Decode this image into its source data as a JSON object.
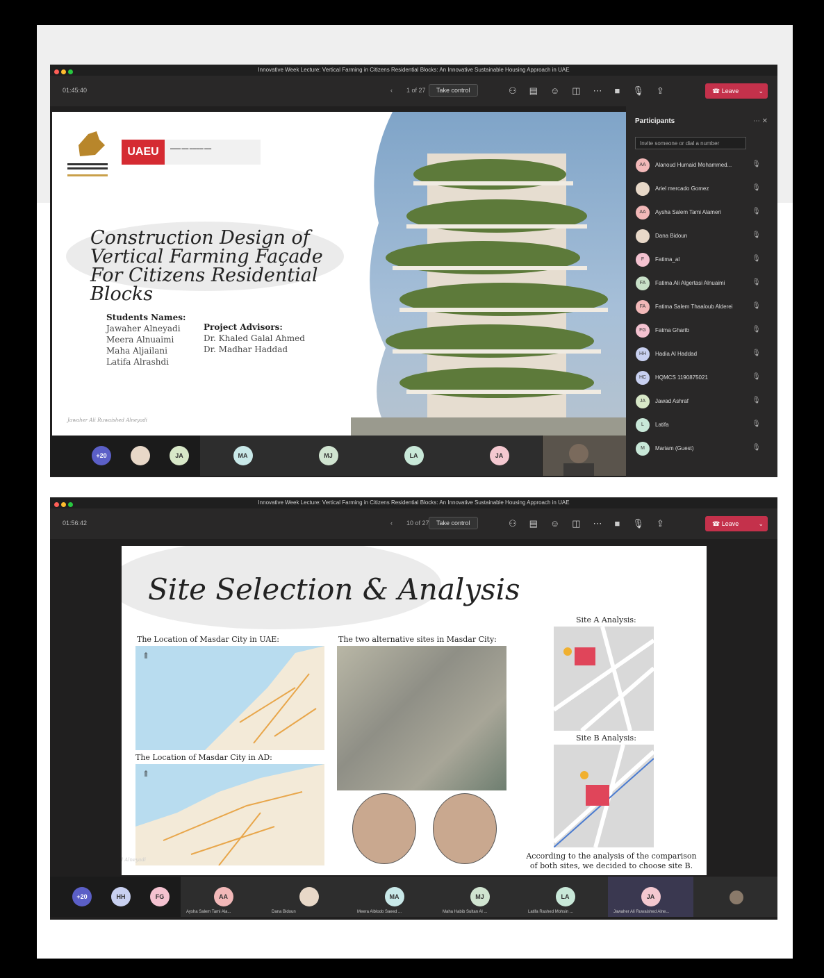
{
  "window_title": "Innovative Week Lecture: Vertical Farming in Citizens Residential Blocks: An Innovative Sustainable Housing Approach in UAE",
  "toolbar": {
    "take_control": "Take control",
    "leave": "Leave"
  },
  "meeting1": {
    "timer": "01:45:40",
    "slide_count": "1 of 27",
    "slide": {
      "title": "Construction Design of Vertical Farming Façade For Citizens Residential Blocks",
      "logo_text": "UAEU",
      "students_heading": "Students Names:",
      "students": [
        "Jawaher Alneyadi",
        "Meera Alnuaimi",
        "Maha Aljailani",
        "Latifa Alrashdi"
      ],
      "advisors_heading": "Project Advisors:",
      "advisors": [
        "Dr. Khaled Galal Ahmed",
        "Dr. Madhar Haddad"
      ],
      "footer": "Jawaher Ali Ruwaished Alneyadi"
    },
    "participants_title": "Participants",
    "invite_placeholder": "Invite someone or dial a number",
    "participants": [
      {
        "initials": "AA",
        "name": "Alanoud Humaid Mohammed...",
        "color": "#f2b8b8"
      },
      {
        "initials": "",
        "name": "Ariel mercado Gomez",
        "color": "#e8d8c8"
      },
      {
        "initials": "AA",
        "name": "Aysha Salem Tami Alameri",
        "color": "#f2b8b8"
      },
      {
        "initials": "",
        "name": "Dana Bidoun",
        "color": "#e8d8c8"
      },
      {
        "initials": "F",
        "name": "Fatima_al",
        "color": "#f4c2d0"
      },
      {
        "initials": "FA",
        "name": "Fatima Ali Algertasi Alnuaimi",
        "color": "#c8e0c8"
      },
      {
        "initials": "FA",
        "name": "Fatima Salem Thaaloub Alderei",
        "color": "#f2b8b8"
      },
      {
        "initials": "FG",
        "name": "Fatma Gharib",
        "color": "#f4c2d0"
      },
      {
        "initials": "HH",
        "name": "Hadia Al Haddad",
        "color": "#c8d0f0"
      },
      {
        "initials": "HC",
        "name": "HQMCS 1190875021",
        "color": "#c8d0f0"
      },
      {
        "initials": "JA",
        "name": "Jawad Ashraf",
        "color": "#d8e8c8"
      },
      {
        "initials": "L",
        "name": "Latifa",
        "color": "#c8e8d8"
      },
      {
        "initials": "M",
        "name": "Mariam (Guest)",
        "color": "#c8e8d8"
      }
    ],
    "strip": [
      {
        "initials": "+20",
        "color": "#5b5fc7"
      },
      {
        "initials": "",
        "color": "#e8d8c8"
      },
      {
        "initials": "JA",
        "color": "#d8e8c8"
      },
      {
        "initials": "MA",
        "color": "#c8e8e8"
      },
      {
        "initials": "MJ",
        "color": "#d0e4d0"
      },
      {
        "initials": "LA",
        "color": "#c8e8d8"
      },
      {
        "initials": "JA",
        "color": "#f4c8d0"
      }
    ]
  },
  "meeting2": {
    "timer": "01:56:42",
    "slide_count": "10 of 27",
    "slide": {
      "title": "Site Selection & Analysis",
      "cap_uae": "The Location of Masdar City in UAE:",
      "cap_ad": "The Location of Masdar City in AD:",
      "cap_sites": "The two alternative sites in Masdar City:",
      "site_a": "Site A Analysis:",
      "site_b": "Site B Analysis:",
      "conclusion": "According to the analysis of the comparison of both sites, we decided to choose site B.",
      "footer": "Jawaher Ali Ruwaished Alneyadi"
    },
    "strip": [
      {
        "initials": "+20",
        "color": "#5b5fc7",
        "name": ""
      },
      {
        "initials": "HH",
        "color": "#c8d0f0",
        "name": ""
      },
      {
        "initials": "FG",
        "color": "#f4c2d0",
        "name": ""
      },
      {
        "initials": "AA",
        "color": "#f2b8b8",
        "name": "Aysha Salem Tami Ala..."
      },
      {
        "initials": "",
        "color": "#e8d8c8",
        "name": "Dana Bidoun"
      },
      {
        "initials": "MA",
        "color": "#c8e8e8",
        "name": "Meera Albloob Saeed ..."
      },
      {
        "initials": "MJ",
        "color": "#d0e4d0",
        "name": "Maha Habib Sultan Al ..."
      },
      {
        "initials": "LA",
        "color": "#c8e8d8",
        "name": "Latifa Rashed Mohsin ..."
      },
      {
        "initials": "JA",
        "color": "#f4c8d0",
        "name": "Jawaher Ali Ruwaished Alne..."
      }
    ]
  }
}
